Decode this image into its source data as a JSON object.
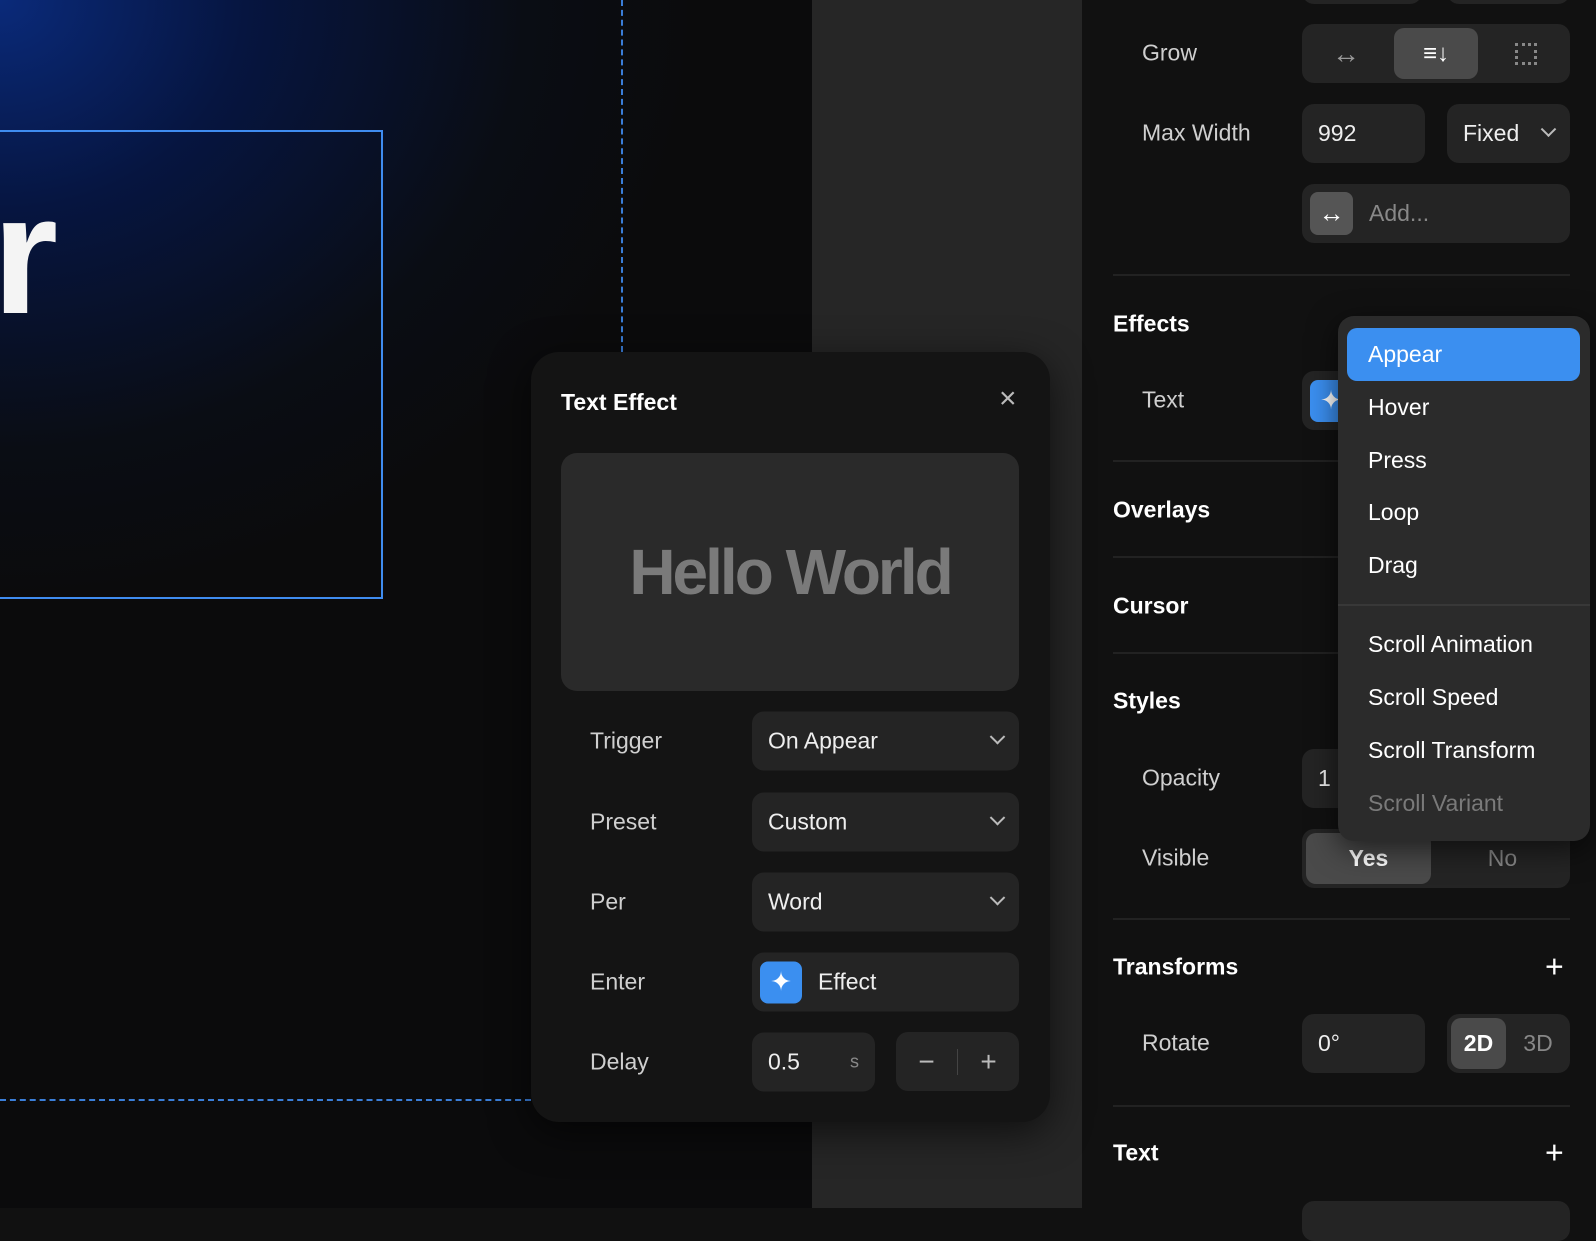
{
  "canvas": {
    "text_fragment": "r"
  },
  "popup": {
    "title": "Text Effect",
    "preview_text": "Hello World",
    "rows": {
      "trigger": {
        "label": "Trigger",
        "value": "On Appear"
      },
      "preset": {
        "label": "Preset",
        "value": "Custom"
      },
      "per": {
        "label": "Per",
        "value": "Word"
      },
      "enter": {
        "label": "Enter",
        "value": "Effect"
      },
      "delay": {
        "label": "Delay",
        "value": "0.5",
        "unit": "s"
      }
    }
  },
  "panel": {
    "grow": {
      "label": "Grow"
    },
    "max_width": {
      "label": "Max Width",
      "value": "992",
      "mode": "Fixed"
    },
    "add": {
      "placeholder": "Add..."
    },
    "effects": {
      "title": "Effects",
      "text_label": "Text"
    },
    "overlays": {
      "title": "Overlays"
    },
    "cursor": {
      "title": "Cursor"
    },
    "styles": {
      "title": "Styles",
      "opacity_label": "Opacity",
      "opacity_value": "1",
      "visible_label": "Visible",
      "yes": "Yes",
      "no": "No"
    },
    "transforms": {
      "title": "Transforms",
      "rotate_label": "Rotate",
      "rotate_value": "0°",
      "d2": "2D",
      "d3": "3D"
    },
    "text": {
      "title": "Text"
    }
  },
  "menu": {
    "items": [
      "Appear",
      "Hover",
      "Press",
      "Loop",
      "Drag"
    ],
    "scroll_items": [
      "Scroll Animation",
      "Scroll Speed",
      "Scroll Transform",
      "Scroll Variant"
    ]
  },
  "colors": {
    "accent": "#3b8ff0",
    "panel": "#111111"
  }
}
